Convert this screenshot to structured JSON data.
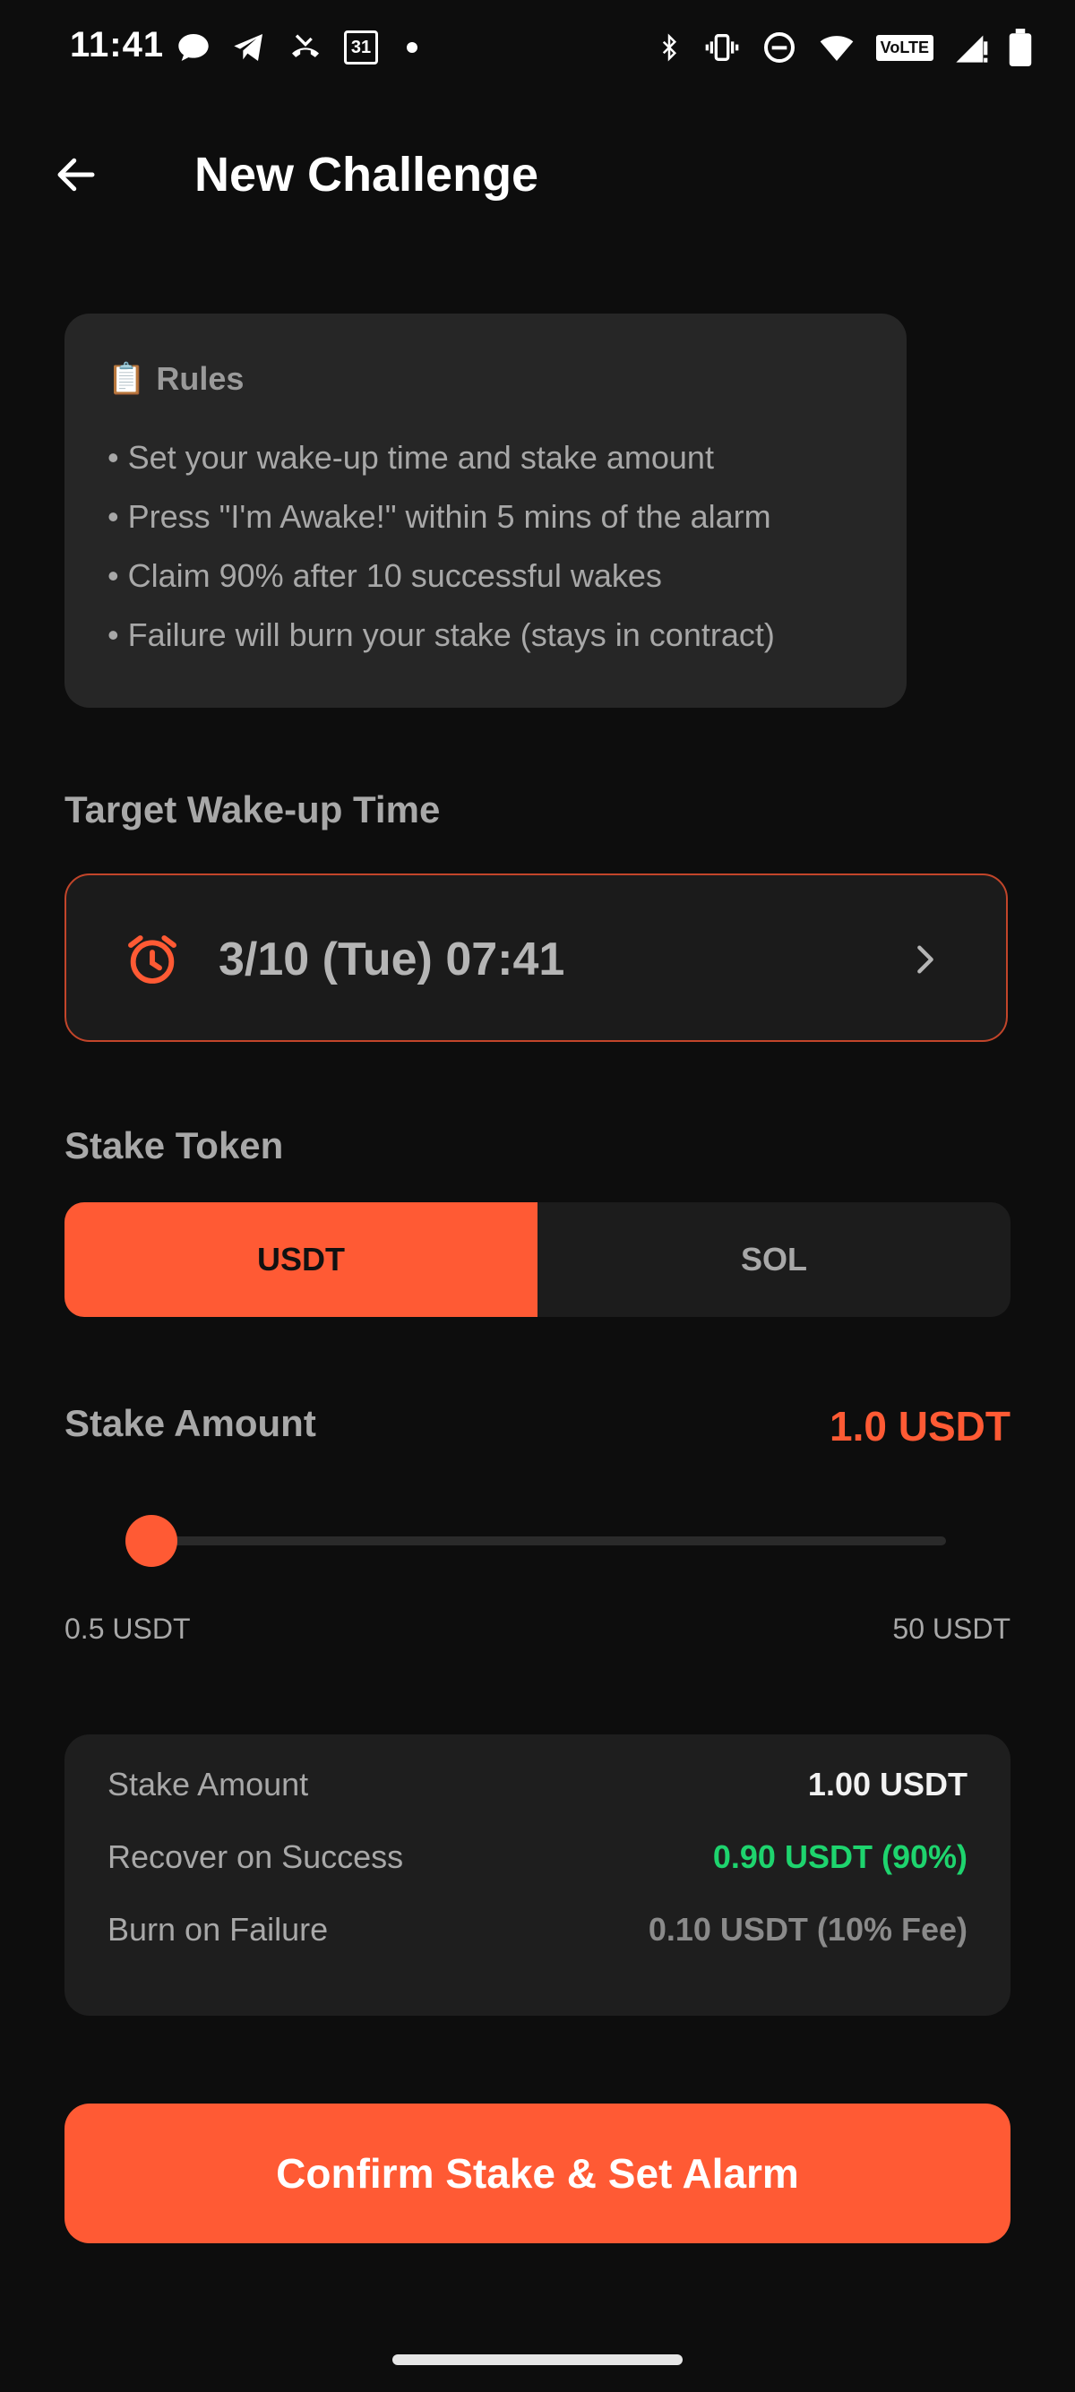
{
  "status_bar": {
    "time": "11:41",
    "left_icons": [
      "chat-bubble-icon",
      "telegram-icon",
      "missed-call-icon",
      "calendar-icon",
      "dot-icon"
    ],
    "calendar_day": "31",
    "right_icons": [
      "bluetooth-icon",
      "vibrate-icon",
      "dnd-icon",
      "wifi-icon",
      "volte-icon",
      "signal-icon",
      "battery-icon"
    ],
    "volte_label": "VoLTE"
  },
  "app_bar": {
    "title": "New Challenge"
  },
  "rules": {
    "icon": "📋",
    "title": "Rules",
    "items": [
      "• Set your wake-up time and stake amount",
      "• Press \"I'm Awake!\" within 5 mins of the alarm",
      "• Claim 90% after 10 successful wakes",
      "• Failure will burn your stake (stays in contract)"
    ]
  },
  "wake_time": {
    "label": "Target Wake-up Time",
    "value": "3/10 (Tue) 07:41"
  },
  "stake_token": {
    "label": "Stake Token",
    "options": [
      "USDT",
      "SOL"
    ],
    "selected": "USDT"
  },
  "stake_amount": {
    "label": "Stake Amount",
    "value_display": "1.0 USDT",
    "min_label": "0.5 USDT",
    "max_label": "50 USDT",
    "min": 0.5,
    "max": 50,
    "current": 1.0
  },
  "summary": {
    "rows": [
      {
        "label": "Stake Amount",
        "value": "1.00 USDT"
      },
      {
        "label": "Recover on Success",
        "value": "0.90 USDT (90%)"
      },
      {
        "label": "Burn on Failure",
        "value": "0.10 USDT (10% Fee)"
      }
    ]
  },
  "confirm_button": {
    "label": "Confirm Stake & Set Alarm"
  },
  "colors": {
    "accent": "#ff5a34",
    "success": "#1ed46e",
    "background": "#0d0d0d",
    "card": "#262626"
  }
}
